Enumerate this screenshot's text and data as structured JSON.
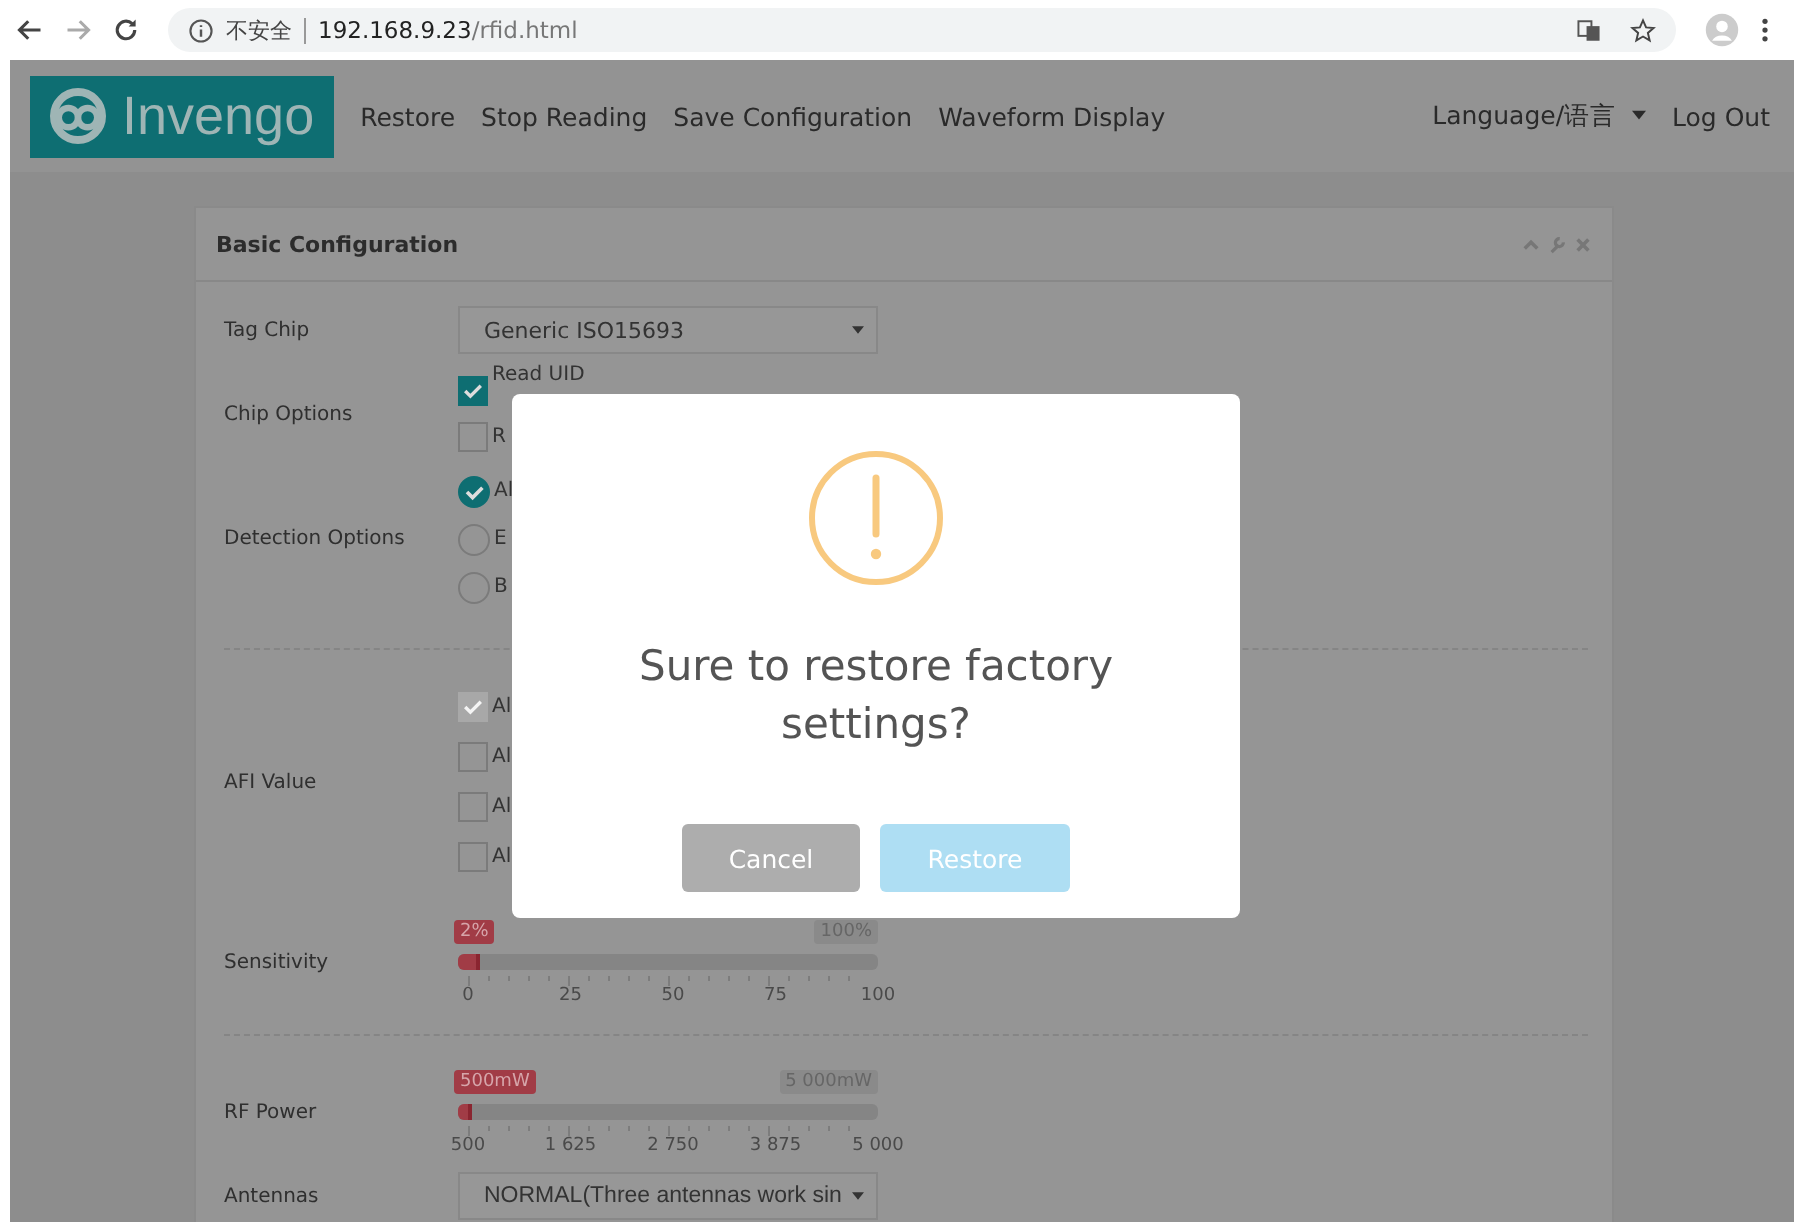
{
  "browser": {
    "security": "不安全",
    "url_host": "192.168.9.23",
    "url_path": "/rfid.html"
  },
  "nav": {
    "logo": "Invengo",
    "links": [
      "Restore",
      "Stop Reading",
      "Save Configuration",
      "Waveform Display"
    ],
    "language": "Language/语言",
    "logout": "Log Out"
  },
  "panel": {
    "title": "Basic Configuration",
    "tag_chip": {
      "label": "Tag Chip",
      "value": "Generic ISO15693"
    },
    "chip_options": {
      "label": "Chip Options",
      "items": [
        {
          "text": "Read UID",
          "checked": true
        },
        {
          "text": "R",
          "checked": false
        }
      ]
    },
    "detection_options": {
      "label": "Detection Options",
      "items": [
        {
          "text": "Al",
          "selected": true
        },
        {
          "text": "E",
          "selected": false
        },
        {
          "text": "B",
          "selected": false
        }
      ]
    },
    "afi_value": {
      "label": "AFI Value",
      "items": [
        {
          "text": "Al",
          "checked": true,
          "disabled": true
        },
        {
          "text": "Al",
          "checked": false,
          "disabled": false
        },
        {
          "text": "Al",
          "checked": false,
          "disabled": false
        },
        {
          "text": "Al",
          "checked": false,
          "disabled": false
        }
      ]
    },
    "sliders": [
      {
        "label": "Sensitivity",
        "value": "2%",
        "max": "100%",
        "level": 0.02,
        "ticks": [
          "0",
          "25",
          "50",
          "75",
          "100"
        ]
      },
      {
        "label": "RF Power",
        "value": "500mW",
        "max": "5 000mW",
        "level": 0.0,
        "ticks": [
          "500",
          "1 625",
          "2 750",
          "3 875",
          "5 000"
        ]
      }
    ],
    "antennas": {
      "label": "Antennas",
      "value": "NORMAL(Three antennas work sin"
    }
  },
  "dialog": {
    "message": "Sure to restore factory settings?",
    "buttons": [
      {
        "label": "Cancel",
        "kind": "cancel"
      },
      {
        "label": "Restore",
        "kind": "confirm"
      }
    ]
  }
}
